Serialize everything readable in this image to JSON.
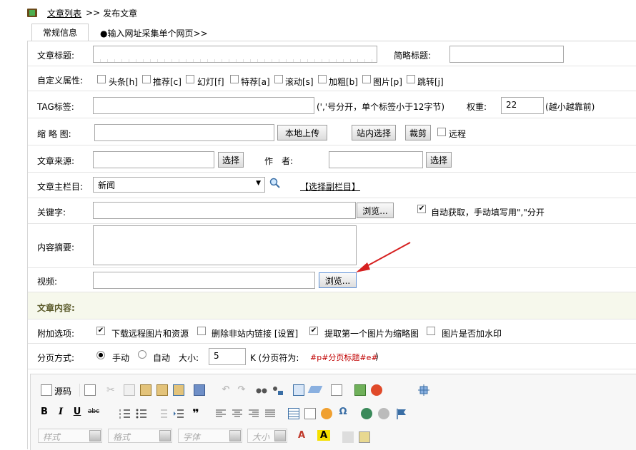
{
  "breadcrumb": {
    "list_link": "文章列表",
    "sep": ">>",
    "current": "发布文章"
  },
  "tabs": [
    "常规信息",
    "●输入网址采集单个网页>>"
  ],
  "form": {
    "title_label": "文章标题:",
    "short_title_label": "简略标题:",
    "custom_attr_label": "自定义属性:",
    "attrs": [
      "头条[h]",
      "推荐[c]",
      "幻灯[f]",
      "特荐[a]",
      "滚动[s]",
      "加粗[b]",
      "图片[p]",
      "跳转[j]"
    ],
    "tag_label": "TAG标签:",
    "tag_hint": "(','号分开，单个标签小于12字节)",
    "weight_label": "权重:",
    "weight_value": "22",
    "weight_hint": "(越小越靠前)",
    "thumb_label": "缩 略 图:",
    "upload_btn": "本地上传",
    "site_select_btn": "站内选择",
    "crop_btn": "裁剪",
    "remote_label": "远程",
    "source_label": "文章来源:",
    "select_btn": "选择",
    "author_label": "作　者:",
    "main_cat_label": "文章主栏目:",
    "main_cat_value": "新闻",
    "sub_cat_link": "【选择副栏目】",
    "keywords_label": "关键字:",
    "browse_btn": "浏览...",
    "auto_keyword_label": "自动获取，手动填写用\",\"分开",
    "summary_label": "内容摘要:",
    "video_label": "视频:",
    "content_section": "文章内容:",
    "extra_label": "附加选项:",
    "extras": [
      "下载远程图片和资源",
      "删除非站内链接 [设置]",
      "提取第一个图片为缩略图",
      "图片是否加水印"
    ],
    "paging_label": "分页方式:",
    "paging_manual": "手动",
    "paging_auto": "自动",
    "size_label": "大小:",
    "size_value": "5",
    "size_hint_prefix": "K (分页符为:",
    "page_token": "#p#分页标题#e#",
    "size_hint_suffix": ")"
  },
  "editor": {
    "source_label": "源码",
    "style_placeholder": "样式",
    "format_placeholder": "格式",
    "font_placeholder": "字体",
    "size_placeholder": "大小"
  },
  "colors": {
    "section_bg": "#f6f8ec",
    "section_text": "#5a5a2a",
    "token": "#c00000",
    "arrow": "#d62020"
  }
}
